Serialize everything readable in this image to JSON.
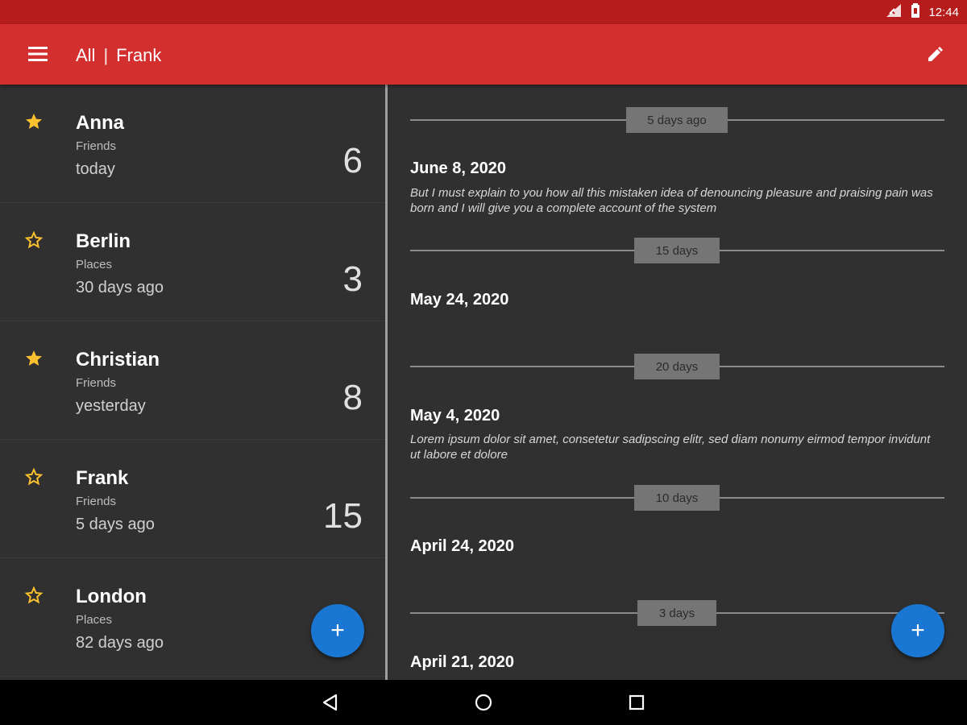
{
  "status": {
    "time": "12:44"
  },
  "appbar": {
    "title_left": "All",
    "separator": "|",
    "title_right": "Frank",
    "menu_icon": "menu-icon",
    "edit_icon": "edit-icon"
  },
  "people": [
    {
      "name": "Anna",
      "category": "Friends",
      "when": "today",
      "count": "6",
      "starred": true
    },
    {
      "name": "Berlin",
      "category": "Places",
      "when": "30 days ago",
      "count": "3",
      "starred": false
    },
    {
      "name": "Christian",
      "category": "Friends",
      "when": "yesterday",
      "count": "8",
      "starred": true
    },
    {
      "name": "Frank",
      "category": "Friends",
      "when": "5 days ago",
      "count": "15",
      "starred": false
    },
    {
      "name": "London",
      "category": "Places",
      "when": "82 days ago",
      "count": "",
      "starred": false
    }
  ],
  "timeline": {
    "gaps": [
      "5 days ago",
      "15 days",
      "20 days",
      "10 days",
      "3 days"
    ],
    "entries": [
      {
        "date": "June 8, 2020",
        "note": "But I must explain to you how all this mistaken idea of denouncing pleasure and praising pain was born and I will give you a complete account of the system"
      },
      {
        "date": "May 24, 2020",
        "note": ""
      },
      {
        "date": "May 4, 2020",
        "note": "Lorem ipsum dolor sit amet, consetetur sadipscing elitr, sed diam nonumy eirmod tempor invidunt ut labore et dolore"
      },
      {
        "date": "April 24, 2020",
        "note": ""
      },
      {
        "date": "April 21, 2020",
        "note": ""
      }
    ]
  },
  "fab": {
    "label": "+"
  },
  "colors": {
    "statusbar": "#b71c1c",
    "appbar": "#d32f2f",
    "background": "#303030",
    "star": "#fbc02d",
    "fab": "#1976d2"
  }
}
